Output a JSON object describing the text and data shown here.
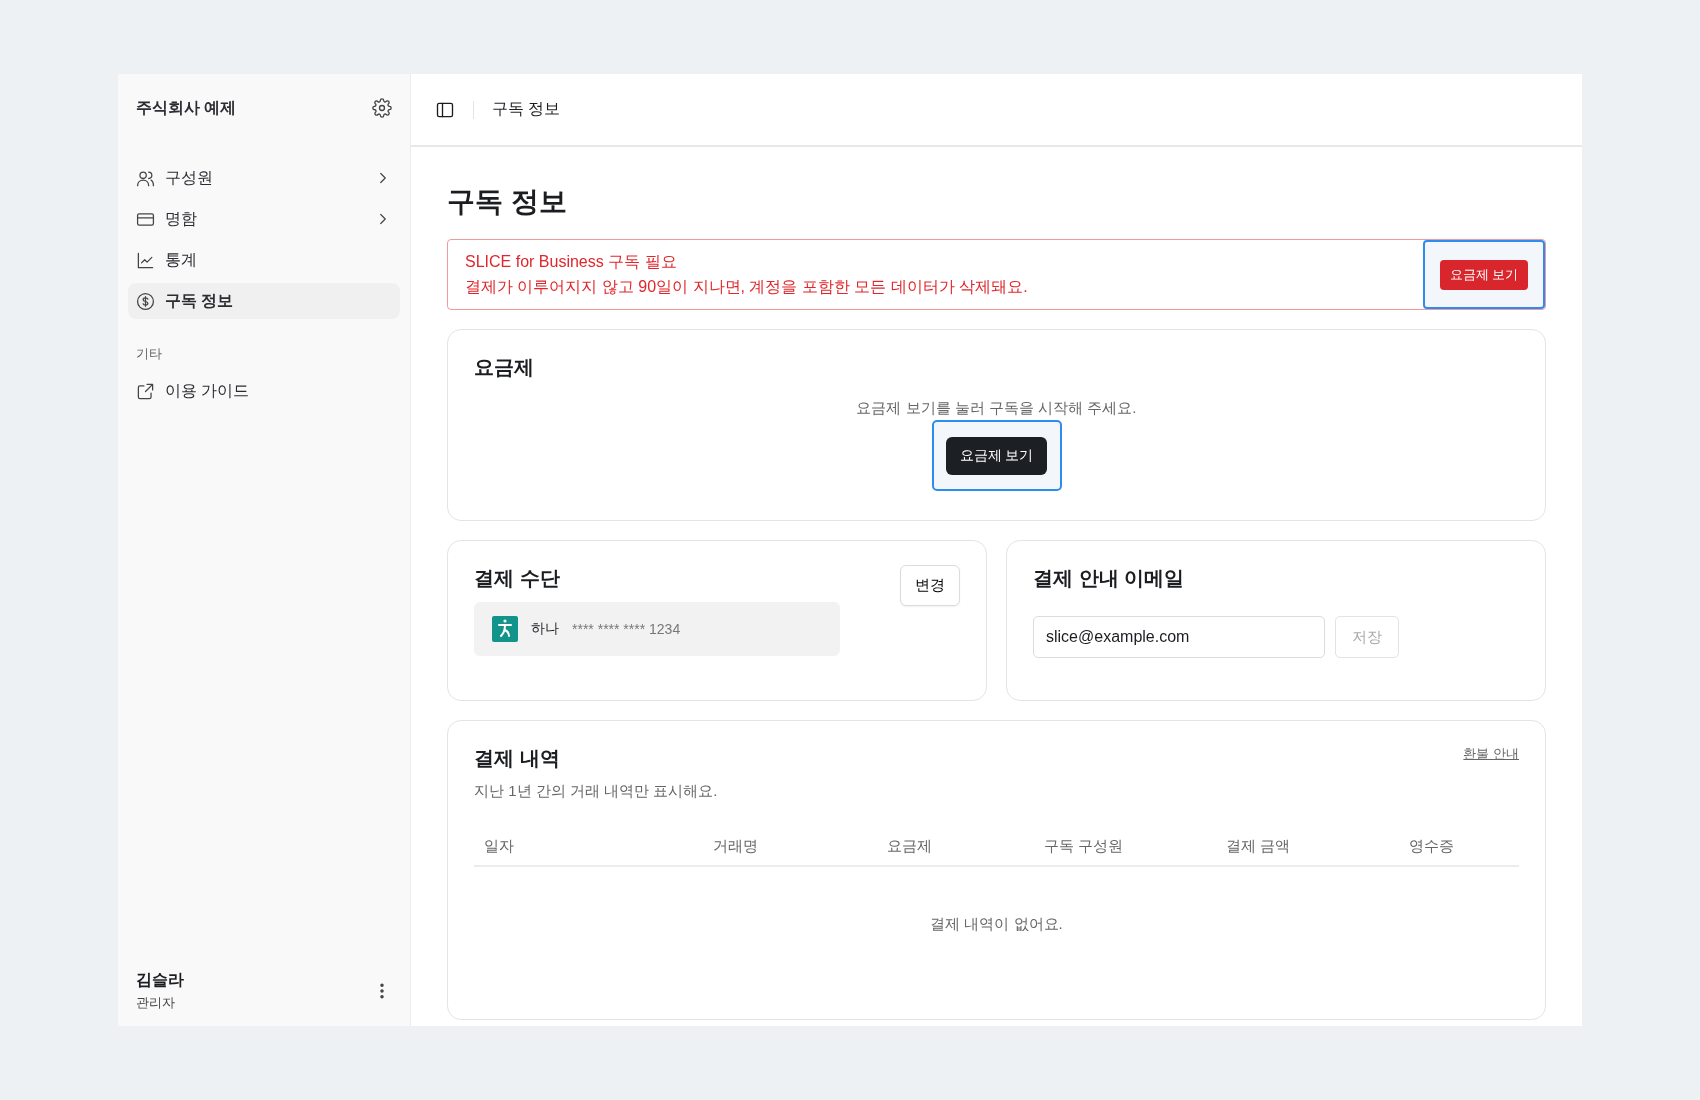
{
  "sidebar": {
    "company": "주식회사 예제",
    "nav": [
      {
        "label": "구성원",
        "has_submenu": true,
        "selected": false
      },
      {
        "label": "명함",
        "has_submenu": true,
        "selected": false
      },
      {
        "label": "통계",
        "has_submenu": false,
        "selected": false
      },
      {
        "label": "구독 정보",
        "has_submenu": false,
        "selected": true
      }
    ],
    "section_label": "기타",
    "links": [
      {
        "label": "이용 가이드"
      }
    ],
    "user": {
      "name": "김슬라",
      "role": "관리자"
    }
  },
  "header": {
    "breadcrumb": "구독 정보"
  },
  "page_title": "구독 정보",
  "alert": {
    "title": "SLICE for Business 구독 필요",
    "message": "결제가 이루어지지 않고 90일이 지나면, 계정을 포함한 모든 데이터가 삭제돼요.",
    "button": {
      "label": "요금제 보기",
      "highlighted": true
    }
  },
  "plan_card": {
    "title": "요금제",
    "message": "요금제 보기를 눌러 구독을 시작해 주세요.",
    "button": {
      "label": "요금제 보기",
      "highlighted": true
    }
  },
  "payment_method": {
    "title": "결제 수단",
    "change_button": "변경",
    "card": {
      "bank": "하나",
      "number": "**** **** **** 1234"
    }
  },
  "billing_email": {
    "title": "결제 안내 이메일",
    "value": "slice@example.com",
    "save_button": {
      "label": "저장",
      "disabled": true
    }
  },
  "history": {
    "title": "결제 내역",
    "subtitle": "지난 1년 간의 거래 내역만 표시해요.",
    "refund_link": "환불 안내",
    "columns": [
      "일자",
      "거래명",
      "요금제",
      "구독 구성원",
      "결제 금액",
      "영수증"
    ],
    "empty_message": "결제 내역이 없어요."
  }
}
